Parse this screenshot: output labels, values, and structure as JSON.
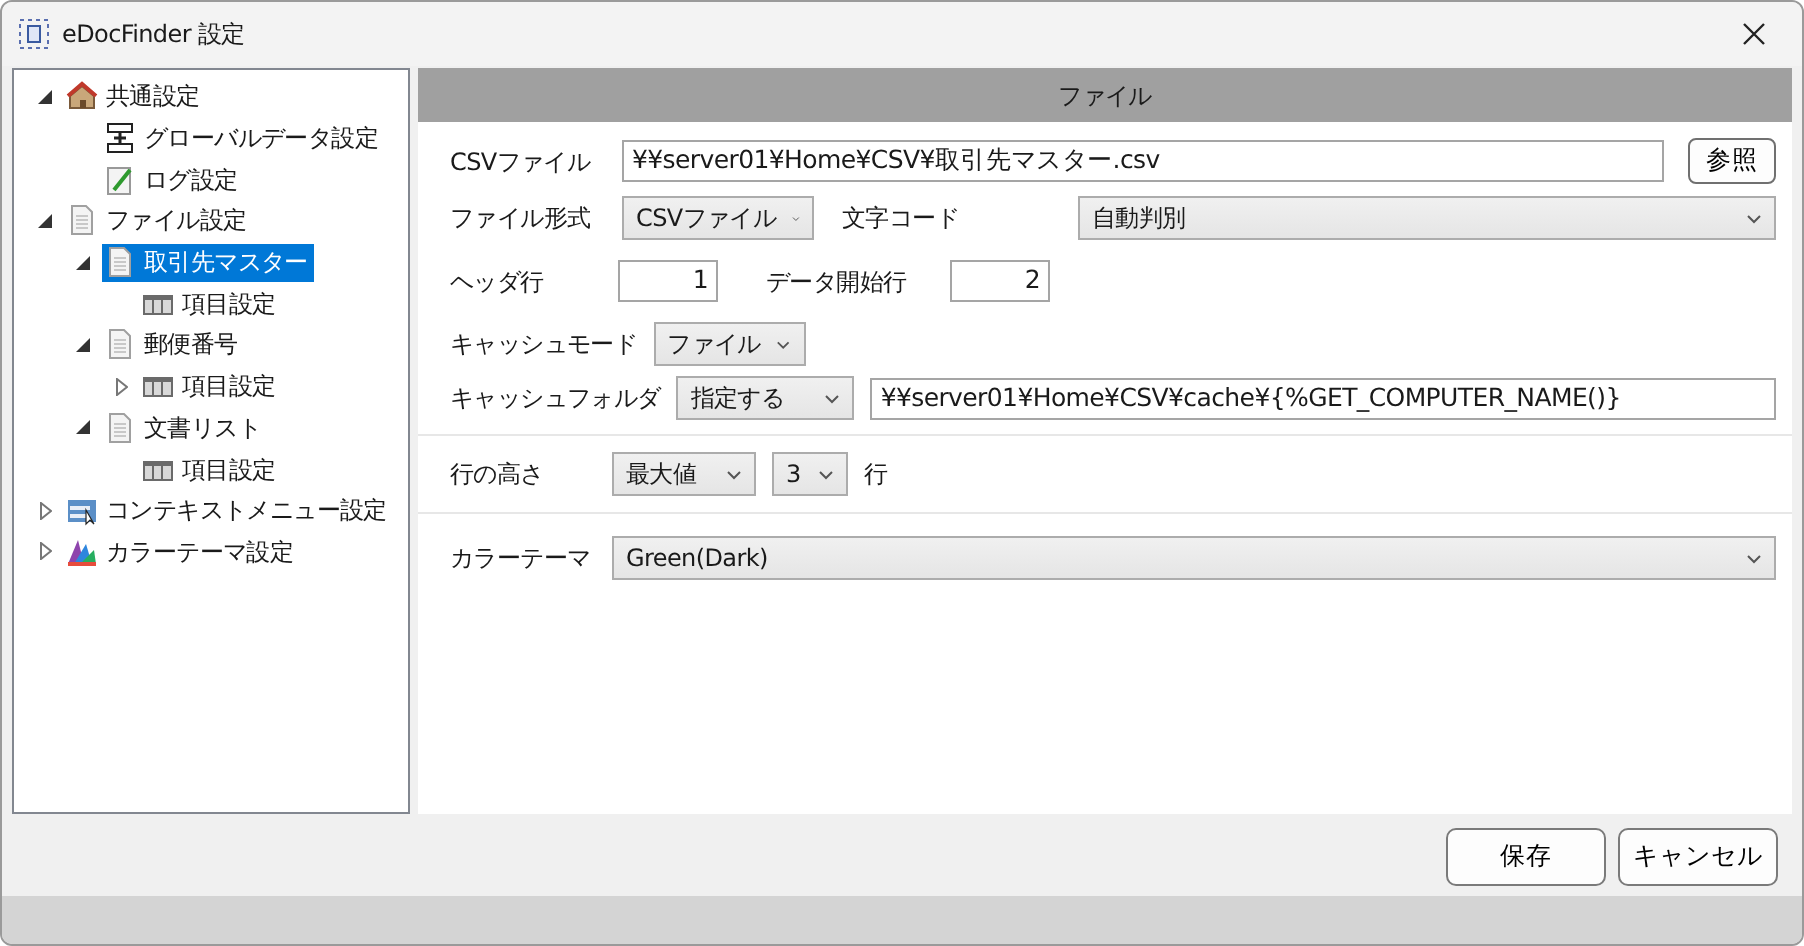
{
  "window": {
    "title": "eDocFinder 設定"
  },
  "tree": [
    {
      "label": "共通設定",
      "kind": "house",
      "expanded": true,
      "selected": false,
      "children": [
        {
          "label": "グローバルデータ設定",
          "kind": "server",
          "selected": false
        },
        {
          "label": "ログ設定",
          "kind": "note",
          "selected": false
        }
      ]
    },
    {
      "label": "ファイル設定",
      "kind": "doc",
      "expanded": true,
      "selected": false,
      "children": [
        {
          "label": "取引先マスター",
          "kind": "doc",
          "expanded": true,
          "selected": true,
          "children": [
            {
              "label": "項目設定",
              "kind": "table",
              "selected": false
            }
          ]
        },
        {
          "label": "郵便番号",
          "kind": "doc",
          "expanded": true,
          "selected": false,
          "children": [
            {
              "label": "項目設定",
              "kind": "table",
              "expanded": false,
              "selected": false
            }
          ]
        },
        {
          "label": "文書リスト",
          "kind": "doc",
          "expanded": true,
          "selected": false,
          "children": [
            {
              "label": "項目設定",
              "kind": "table",
              "selected": false
            }
          ]
        }
      ]
    },
    {
      "label": "コンテキストメニュー設定",
      "kind": "menu",
      "expanded": false,
      "selected": false
    },
    {
      "label": "カラーテーマ設定",
      "kind": "palette",
      "expanded": false,
      "selected": false
    }
  ],
  "panel": {
    "header": "ファイル",
    "csv_file": {
      "label": "CSVファイル",
      "value": "¥¥server01¥Home¥CSV¥取引先マスター.csv",
      "button": "参照"
    },
    "file_format": {
      "label": "ファイル形式",
      "value": "CSVファイル"
    },
    "char_code": {
      "label": "文字コード",
      "value": "自動判別"
    },
    "header_row": {
      "label": "ヘッダ行",
      "value": "1"
    },
    "data_start_row": {
      "label": "データ開始行",
      "value": "2"
    },
    "cache_mode": {
      "label": "キャッシュモード",
      "value": "ファイル"
    },
    "cache_folder": {
      "label": "キャッシュフォルダ",
      "mode": "指定する",
      "value": "¥¥server01¥Home¥CSV¥cache¥{%GET_COMPUTER_NAME()}"
    },
    "row_height": {
      "label": "行の高さ",
      "mode": "最大値",
      "count": "3",
      "unit": "行"
    },
    "color_theme": {
      "label": "カラーテーマ",
      "value": "Green(Dark)"
    }
  },
  "buttons": [
    "保存",
    "キャンセル"
  ]
}
